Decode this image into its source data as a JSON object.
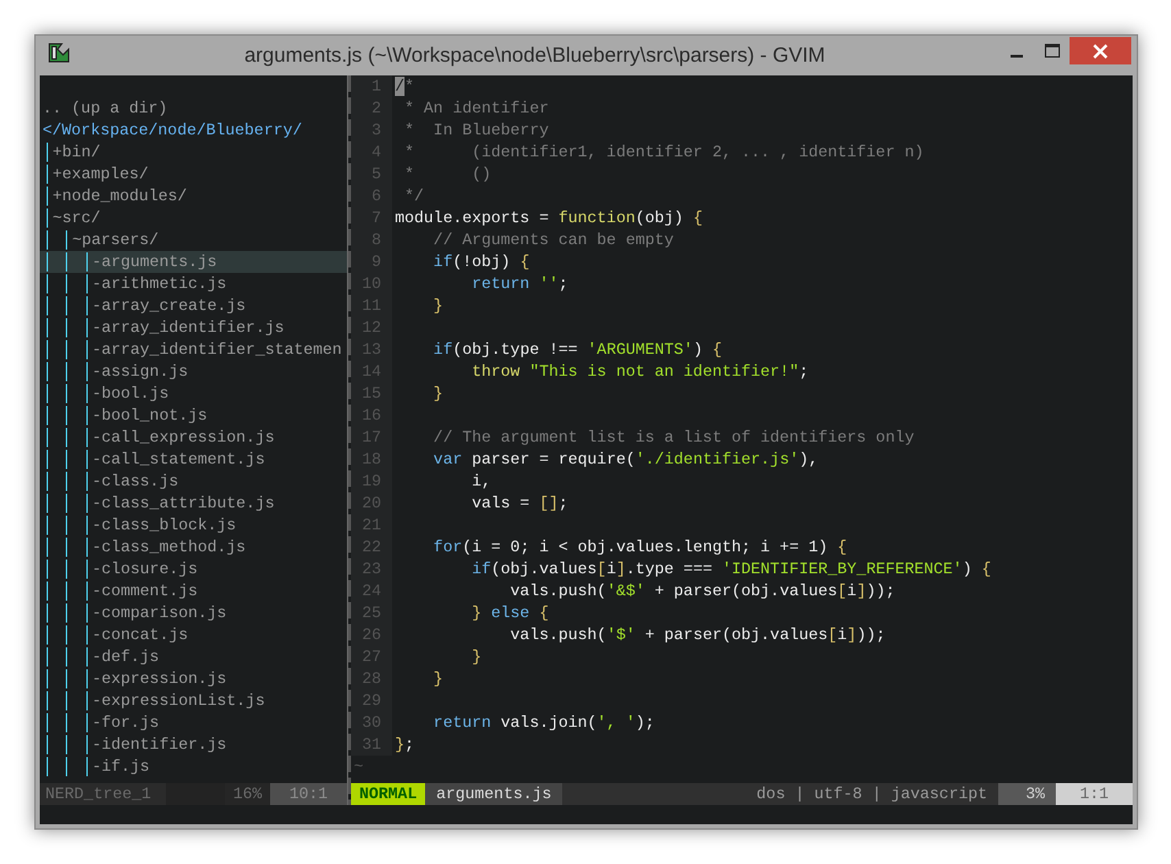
{
  "window": {
    "title": "arguments.js (~\\Workspace\\node\\Blueberry\\src\\parsers) - GVIM"
  },
  "tree": {
    "up": ".. (up a dir)",
    "root": "</Workspace/node/Blueberry/",
    "items": [
      {
        "marker": "+",
        "label": "bin/",
        "selected": false
      },
      {
        "marker": "+",
        "label": "examples/",
        "selected": false
      },
      {
        "marker": "+",
        "label": "node_modules/",
        "selected": false
      },
      {
        "marker": "~",
        "label": "src/",
        "selected": false,
        "children": [
          {
            "marker": "~",
            "label": "parsers/",
            "selected": false,
            "children": [
              {
                "marker": "-",
                "label": "arguments.js",
                "selected": true
              },
              {
                "marker": "-",
                "label": "arithmetic.js",
                "selected": false
              },
              {
                "marker": "-",
                "label": "array_create.js",
                "selected": false
              },
              {
                "marker": "-",
                "label": "array_identifier.js",
                "selected": false
              },
              {
                "marker": "-",
                "label": "array_identifier_statemen",
                "selected": false
              },
              {
                "marker": "-",
                "label": "assign.js",
                "selected": false
              },
              {
                "marker": "-",
                "label": "bool.js",
                "selected": false
              },
              {
                "marker": "-",
                "label": "bool_not.js",
                "selected": false
              },
              {
                "marker": "-",
                "label": "call_expression.js",
                "selected": false
              },
              {
                "marker": "-",
                "label": "call_statement.js",
                "selected": false
              },
              {
                "marker": "-",
                "label": "class.js",
                "selected": false
              },
              {
                "marker": "-",
                "label": "class_attribute.js",
                "selected": false
              },
              {
                "marker": "-",
                "label": "class_block.js",
                "selected": false
              },
              {
                "marker": "-",
                "label": "class_method.js",
                "selected": false
              },
              {
                "marker": "-",
                "label": "closure.js",
                "selected": false
              },
              {
                "marker": "-",
                "label": "comment.js",
                "selected": false
              },
              {
                "marker": "-",
                "label": "comparison.js",
                "selected": false
              },
              {
                "marker": "-",
                "label": "concat.js",
                "selected": false
              },
              {
                "marker": "-",
                "label": "def.js",
                "selected": false
              },
              {
                "marker": "-",
                "label": "expression.js",
                "selected": false
              },
              {
                "marker": "-",
                "label": "expressionList.js",
                "selected": false
              },
              {
                "marker": "-",
                "label": "for.js",
                "selected": false
              },
              {
                "marker": "-",
                "label": "identifier.js",
                "selected": false
              },
              {
                "marker": "-",
                "label": "if.js",
                "selected": false
              }
            ]
          }
        ]
      }
    ],
    "status": {
      "name": "NERD_tree_1",
      "percent": "16%",
      "position": "10:1"
    }
  },
  "editor": {
    "lines": [
      {
        "number": "1",
        "tokens": [
          {
            "kind": "cursor",
            "text": "/"
          },
          {
            "kind": "comment",
            "text": "*"
          }
        ]
      },
      {
        "number": "2",
        "tokens": [
          {
            "kind": "comment",
            "text": " * An identifier"
          }
        ]
      },
      {
        "number": "3",
        "tokens": [
          {
            "kind": "comment",
            "text": " *  In Blueberry"
          }
        ]
      },
      {
        "number": "4",
        "tokens": [
          {
            "kind": "comment",
            "text": " *      (identifier1, identifier 2, ... , identifier n)"
          }
        ]
      },
      {
        "number": "5",
        "tokens": [
          {
            "kind": "comment",
            "text": " *      ()"
          }
        ]
      },
      {
        "number": "6",
        "tokens": [
          {
            "kind": "comment",
            "text": " */"
          }
        ]
      },
      {
        "number": "7",
        "tokens": [
          {
            "kind": "plain",
            "text": "module.exports = "
          },
          {
            "kind": "function",
            "text": "function"
          },
          {
            "kind": "plain",
            "text": "(obj) "
          },
          {
            "kind": "brace",
            "text": "{"
          }
        ]
      },
      {
        "number": "8",
        "tokens": [
          {
            "kind": "comment",
            "text": "    // Arguments can be empty"
          }
        ]
      },
      {
        "number": "9",
        "tokens": [
          {
            "kind": "keyword",
            "text": "    if"
          },
          {
            "kind": "plain",
            "text": "(!obj) "
          },
          {
            "kind": "brace",
            "text": "{"
          }
        ]
      },
      {
        "number": "10",
        "tokens": [
          {
            "kind": "keyword",
            "text": "        return "
          },
          {
            "kind": "string",
            "text": "''"
          },
          {
            "kind": "plain",
            "text": ";"
          }
        ]
      },
      {
        "number": "11",
        "tokens": [
          {
            "kind": "brace",
            "text": "    }"
          }
        ]
      },
      {
        "number": "12"
      },
      {
        "number": "13",
        "tokens": [
          {
            "kind": "keyword",
            "text": "    if"
          },
          {
            "kind": "plain",
            "text": "(obj.type !== "
          },
          {
            "kind": "string",
            "text": "'ARGUMENTS'"
          },
          {
            "kind": "plain",
            "text": ") "
          },
          {
            "kind": "brace",
            "text": "{"
          }
        ]
      },
      {
        "number": "14",
        "tokens": [
          {
            "kind": "function",
            "text": "        throw "
          },
          {
            "kind": "string",
            "text": "\"This is not an identifier!\""
          },
          {
            "kind": "plain",
            "text": ";"
          }
        ]
      },
      {
        "number": "15",
        "tokens": [
          {
            "kind": "brace",
            "text": "    }"
          }
        ]
      },
      {
        "number": "16"
      },
      {
        "number": "17",
        "tokens": [
          {
            "kind": "comment",
            "text": "    // The argument list is a list of identifiers only"
          }
        ]
      },
      {
        "number": "18",
        "tokens": [
          {
            "kind": "keyword",
            "text": "    var"
          },
          {
            "kind": "plain",
            "text": " parser = require("
          },
          {
            "kind": "string",
            "text": "'./identifier.js'"
          },
          {
            "kind": "plain",
            "text": "),"
          }
        ]
      },
      {
        "number": "19",
        "tokens": [
          {
            "kind": "plain",
            "text": "        i,"
          }
        ]
      },
      {
        "number": "20",
        "tokens": [
          {
            "kind": "plain",
            "text": "        vals = "
          },
          {
            "kind": "brace",
            "text": "[]"
          },
          {
            "kind": "plain",
            "text": ";"
          }
        ]
      },
      {
        "number": "21"
      },
      {
        "number": "22",
        "tokens": [
          {
            "kind": "keyword",
            "text": "    for"
          },
          {
            "kind": "plain",
            "text": "(i = 0; i < obj.values.length; i += 1) "
          },
          {
            "kind": "brace",
            "text": "{"
          }
        ]
      },
      {
        "number": "23",
        "tokens": [
          {
            "kind": "keyword",
            "text": "        if"
          },
          {
            "kind": "plain",
            "text": "(obj.values"
          },
          {
            "kind": "brace",
            "text": "["
          },
          {
            "kind": "plain",
            "text": "i"
          },
          {
            "kind": "brace",
            "text": "]"
          },
          {
            "kind": "plain",
            "text": ".type === "
          },
          {
            "kind": "string",
            "text": "'IDENTIFIER_BY_REFERENCE'"
          },
          {
            "kind": "plain",
            "text": ") "
          },
          {
            "kind": "brace",
            "text": "{"
          }
        ]
      },
      {
        "number": "24",
        "tokens": [
          {
            "kind": "plain",
            "text": "            vals.push("
          },
          {
            "kind": "string",
            "text": "'&$'"
          },
          {
            "kind": "plain",
            "text": " + parser(obj.values"
          },
          {
            "kind": "brace",
            "text": "["
          },
          {
            "kind": "plain",
            "text": "i"
          },
          {
            "kind": "brace",
            "text": "]"
          },
          {
            "kind": "plain",
            "text": "));"
          }
        ]
      },
      {
        "number": "25",
        "tokens": [
          {
            "kind": "brace",
            "text": "        } "
          },
          {
            "kind": "keyword",
            "text": "else "
          },
          {
            "kind": "brace",
            "text": "{"
          }
        ]
      },
      {
        "number": "26",
        "tokens": [
          {
            "kind": "plain",
            "text": "            vals.push("
          },
          {
            "kind": "string",
            "text": "'$'"
          },
          {
            "kind": "plain",
            "text": " + parser(obj.values"
          },
          {
            "kind": "brace",
            "text": "["
          },
          {
            "kind": "plain",
            "text": "i"
          },
          {
            "kind": "brace",
            "text": "]"
          },
          {
            "kind": "plain",
            "text": "));"
          }
        ]
      },
      {
        "number": "27",
        "tokens": [
          {
            "kind": "brace",
            "text": "        }"
          }
        ]
      },
      {
        "number": "28",
        "tokens": [
          {
            "kind": "brace",
            "text": "    }"
          }
        ]
      },
      {
        "number": "29"
      },
      {
        "number": "30",
        "tokens": [
          {
            "kind": "keyword",
            "text": "    return"
          },
          {
            "kind": "plain",
            "text": " vals.join("
          },
          {
            "kind": "string",
            "text": "', '"
          },
          {
            "kind": "plain",
            "text": ");"
          }
        ]
      },
      {
        "number": "31",
        "tokens": [
          {
            "kind": "brace",
            "text": "}"
          },
          {
            "kind": "plain",
            "text": ";"
          }
        ]
      }
    ],
    "filler": "~",
    "status": {
      "mode": "NORMAL",
      "file": "arguments.js",
      "info": "dos | utf-8 | javascript",
      "percent": "3%",
      "position": "1:1"
    }
  }
}
